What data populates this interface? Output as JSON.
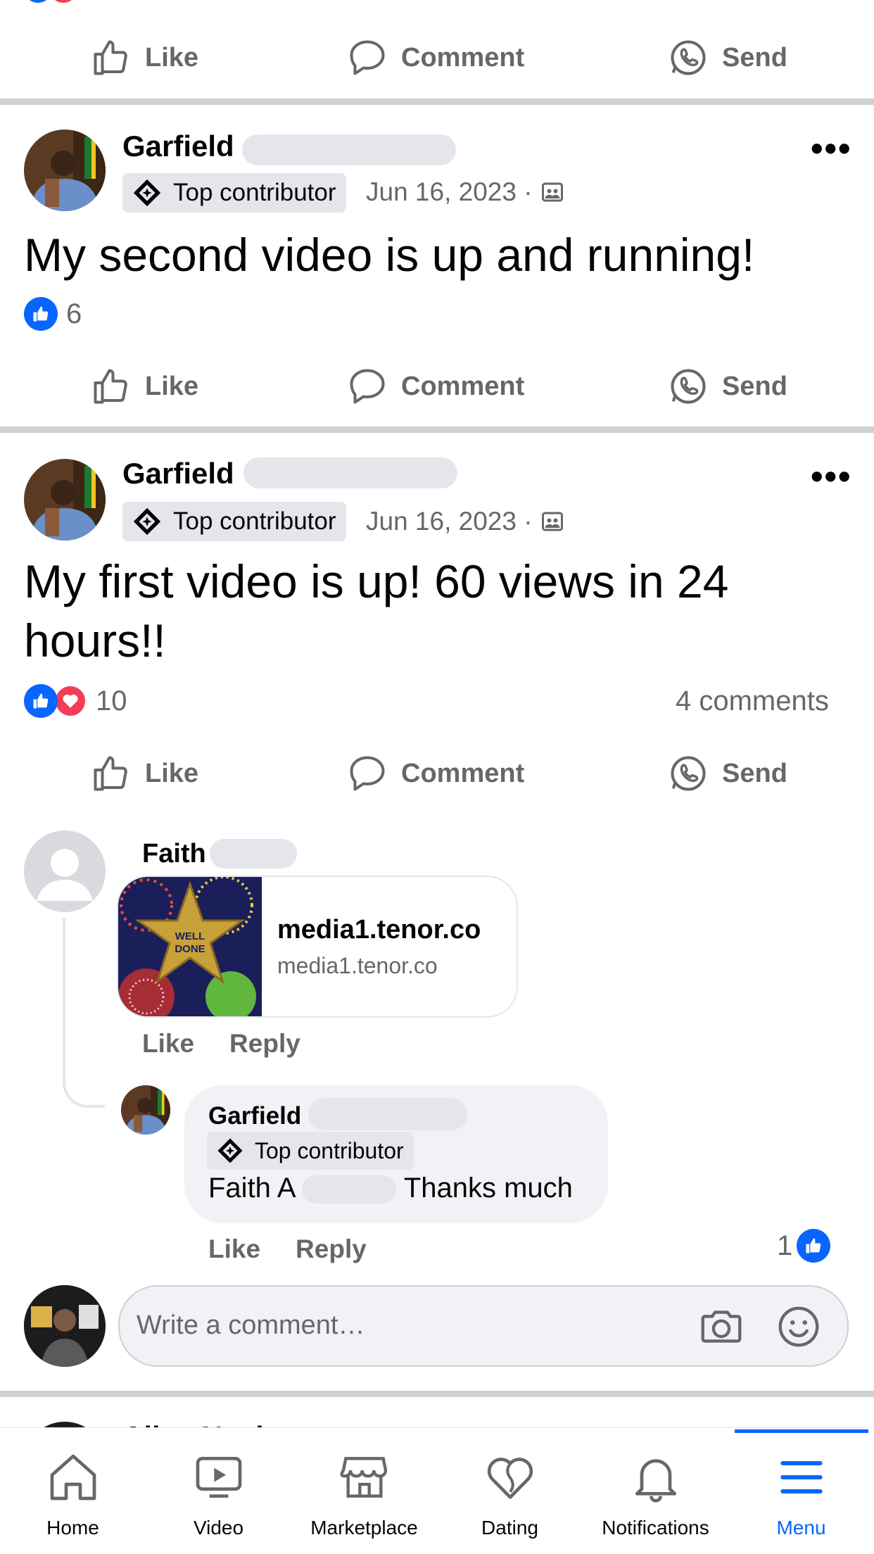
{
  "colors": {
    "brand": "#0866ff",
    "love": "#f33e58",
    "secondary_text": "#65676b",
    "divider": "#ced0d4"
  },
  "actions": {
    "like": "Like",
    "comment": "Comment",
    "send": "Send"
  },
  "post1": {
    "author": "Garfield",
    "badge": "Top contributor",
    "date": "Jun 16, 2023 ·",
    "text": "My second video is up and running!",
    "reaction_count": "6"
  },
  "post2": {
    "author": "Garfield",
    "badge": "Top contributor",
    "date": "Jun 16, 2023 ·",
    "text_line1": "My first video is up! 60 views in 24",
    "text_line2": "hours!!",
    "reaction_count": "10",
    "comments_count": "4 comments",
    "comment1": {
      "author": "Faith",
      "link_title": "media1.tenor.co",
      "link_domain": "media1.tenor.co",
      "gif_text": "WELL DONE",
      "like": "Like",
      "reply": "Reply"
    },
    "reply1": {
      "author": "Garfield",
      "badge": "Top contributor",
      "text_start": "Faith A",
      "text_end": "Thanks much",
      "like": "Like",
      "reply": "Reply",
      "reaction_count": "1"
    }
  },
  "composer": {
    "placeholder": "Write a comment…"
  },
  "next_post": {
    "author_partial": "Alice Nevi"
  },
  "tabs": [
    {
      "label": "Home",
      "icon": "home-icon"
    },
    {
      "label": "Video",
      "icon": "video-icon"
    },
    {
      "label": "Marketplace",
      "icon": "marketplace-icon"
    },
    {
      "label": "Dating",
      "icon": "dating-icon"
    },
    {
      "label": "Notifications",
      "icon": "bell-icon"
    },
    {
      "label": "Menu",
      "icon": "menu-icon",
      "active": true
    }
  ]
}
